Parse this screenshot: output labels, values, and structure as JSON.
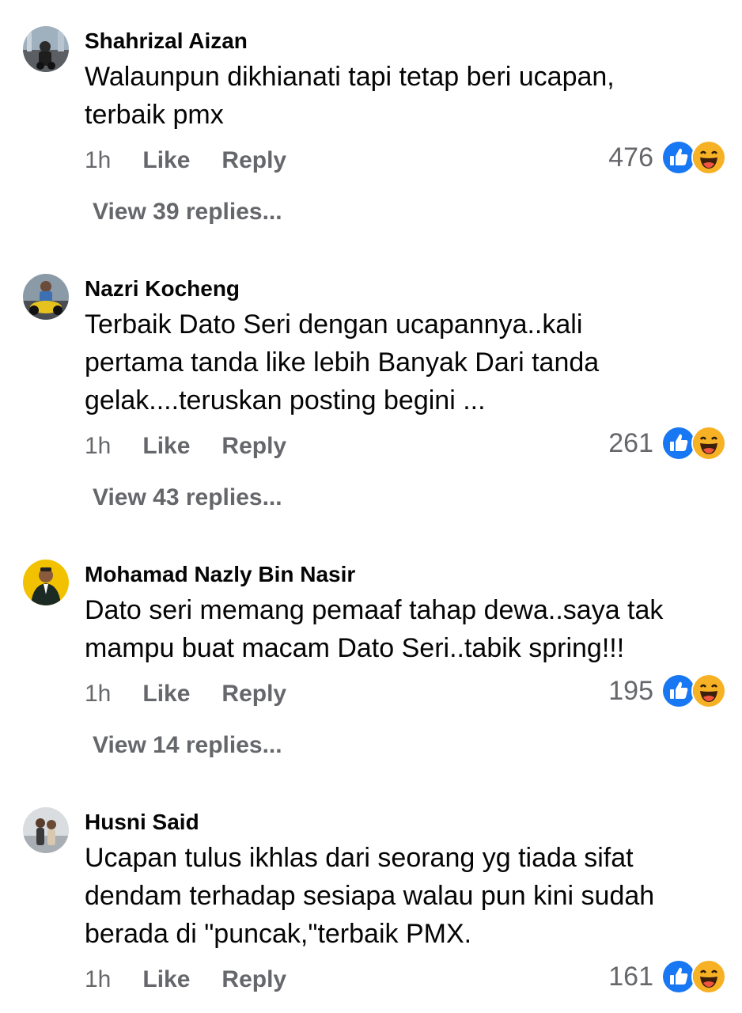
{
  "colors": {
    "like_blue": "#1877f2",
    "haha_yellow": "#f7b125",
    "muted_text": "#65676b"
  },
  "comments": [
    {
      "author": "Shahrizal Aizan",
      "text": "Walaunpun dikhianati tapi tetap beri ucapan,\nterbaik pmx",
      "time": "1h",
      "like_label": "Like",
      "reply_label": "Reply",
      "reaction_count": "476",
      "reaction_icons": [
        "like-icon",
        "haha-icon"
      ],
      "view_replies": "View 39 replies..."
    },
    {
      "author": "Nazri Kocheng",
      "text": "Terbaik Dato Seri dengan ucapannya..kali\npertama tanda like lebih Banyak Dari tanda\ngelak....teruskan posting begini ...",
      "time": "1h",
      "like_label": "Like",
      "reply_label": "Reply",
      "reaction_count": "261",
      "reaction_icons": [
        "like-icon",
        "haha-icon"
      ],
      "view_replies": "View 43 replies..."
    },
    {
      "author": "Mohamad Nazly Bin Nasir",
      "text": "Dato seri memang pemaaf tahap dewa..saya tak\nmampu buat macam Dato Seri..tabik spring!!!",
      "time": "1h",
      "like_label": "Like",
      "reply_label": "Reply",
      "reaction_count": "195",
      "reaction_icons": [
        "like-icon",
        "haha-icon"
      ],
      "view_replies": "View 14 replies..."
    },
    {
      "author": "Husni Said",
      "text": "Ucapan tulus ikhlas dari seorang yg tiada sifat\ndendam terhadap sesiapa walau pun kini sudah\nberada di \"puncak,\"terbaik PMX.",
      "time": "1h",
      "like_label": "Like",
      "reply_label": "Reply",
      "reaction_count": "161",
      "reaction_icons": [
        "like-icon",
        "haha-icon"
      ]
    }
  ]
}
